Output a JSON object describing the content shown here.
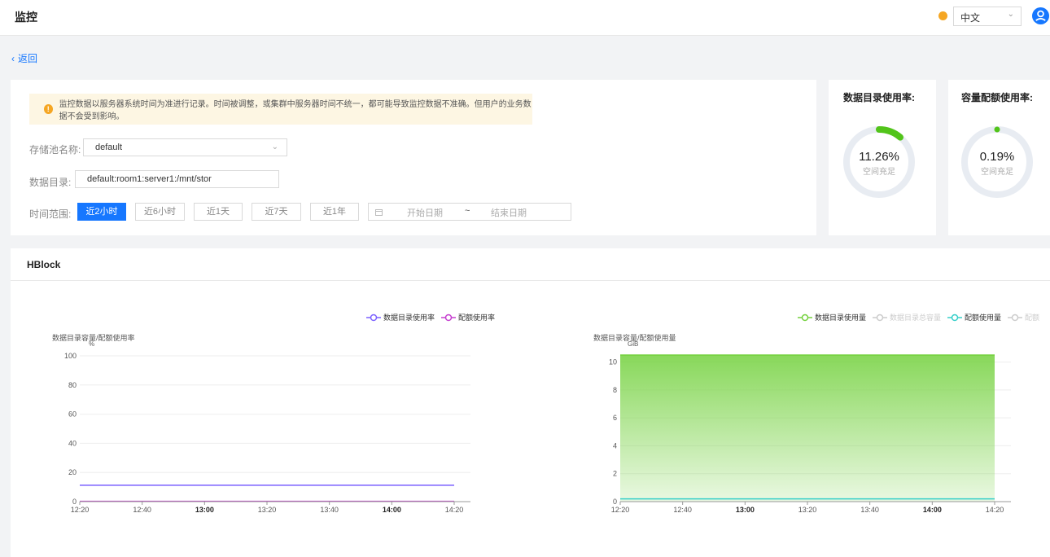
{
  "header": {
    "title": "监控",
    "language": "中文"
  },
  "nav": {
    "back_label": "返回"
  },
  "notice": {
    "text": "监控数据以服务器系统时间为准进行记录。时间被调整，或集群中服务器时间不统一，都可能导致监控数据不准确。但用户的业务数据不会受到影响。"
  },
  "form": {
    "pool_label": "存储池名称:",
    "pool_value": "default",
    "dir_label": "数据目录:",
    "dir_value": "default:room1:server1:/mnt/stor",
    "time_label": "时间范围:",
    "time_buttons": [
      "近2小时",
      "近6小时",
      "近1天",
      "近7天",
      "近1年"
    ],
    "active_time": "近2小时",
    "start_placeholder": "开始日期",
    "range_sep": "~",
    "end_placeholder": "结束日期"
  },
  "cards": [
    {
      "title": "数据目录使用率:",
      "value": "11.26%",
      "percent": 11.26,
      "sub": "空间充足",
      "color": "#52c41a"
    },
    {
      "title": "容量配额使用率:",
      "value": "0.19%",
      "percent": 0.19,
      "sub": "空间充足",
      "color": "#52c41a"
    }
  ],
  "section": {
    "title": "HBlock"
  },
  "colors": {
    "accent": "#1677ff",
    "series_purple": "#7b61ff",
    "series_magenta": "#c53ecf",
    "series_green": "#73d13d",
    "series_cyan": "#36cfc9",
    "series_grey": "#cccccc",
    "warning": "#f5a623"
  },
  "chart_data": [
    {
      "type": "line",
      "title": "",
      "ylabel": "数据目录容量/配额使用率",
      "yunit": "%",
      "ylim": [
        0,
        100
      ],
      "yticks": [
        0,
        20,
        40,
        60,
        80,
        100
      ],
      "x": [
        "12:20",
        "12:40",
        "13:00",
        "13:20",
        "13:40",
        "14:00",
        "14:20"
      ],
      "bold_ticks": [
        "13:00",
        "14:00"
      ],
      "series": [
        {
          "name": "数据目录使用率",
          "values": [
            11.26,
            11.26,
            11.26,
            11.26,
            11.26,
            11.26,
            11.26
          ],
          "color": "#7b61ff",
          "active": true
        },
        {
          "name": "配额使用率",
          "values": [
            0.19,
            0.19,
            0.19,
            0.19,
            0.19,
            0.19,
            0.19
          ],
          "color": "#c53ecf",
          "active": true
        }
      ],
      "legend": "top-right"
    },
    {
      "type": "area",
      "title": "",
      "ylabel": "数据目录容量/配额使用量",
      "yunit": "GiB",
      "ylim": [
        0,
        10.5
      ],
      "yticks": [
        0,
        2,
        4,
        6,
        8,
        10
      ],
      "x": [
        "12:20",
        "12:40",
        "13:00",
        "13:20",
        "13:40",
        "14:00",
        "14:20"
      ],
      "bold_ticks": [
        "13:00",
        "14:00"
      ],
      "series": [
        {
          "name": "数据目录使用量",
          "values": [
            10.5,
            10.5,
            10.5,
            10.5,
            10.5,
            10.5,
            10.5
          ],
          "color": "#73d13d",
          "active": true,
          "fill": true
        },
        {
          "name": "数据目录总容量",
          "values": [],
          "color": "#cccccc",
          "active": false
        },
        {
          "name": "配额使用量",
          "values": [
            0.2,
            0.2,
            0.2,
            0.2,
            0.2,
            0.2,
            0.2
          ],
          "color": "#36cfc9",
          "active": true
        },
        {
          "name": "配额",
          "values": [],
          "color": "#cccccc",
          "active": false
        }
      ],
      "legend": "top-right"
    }
  ]
}
